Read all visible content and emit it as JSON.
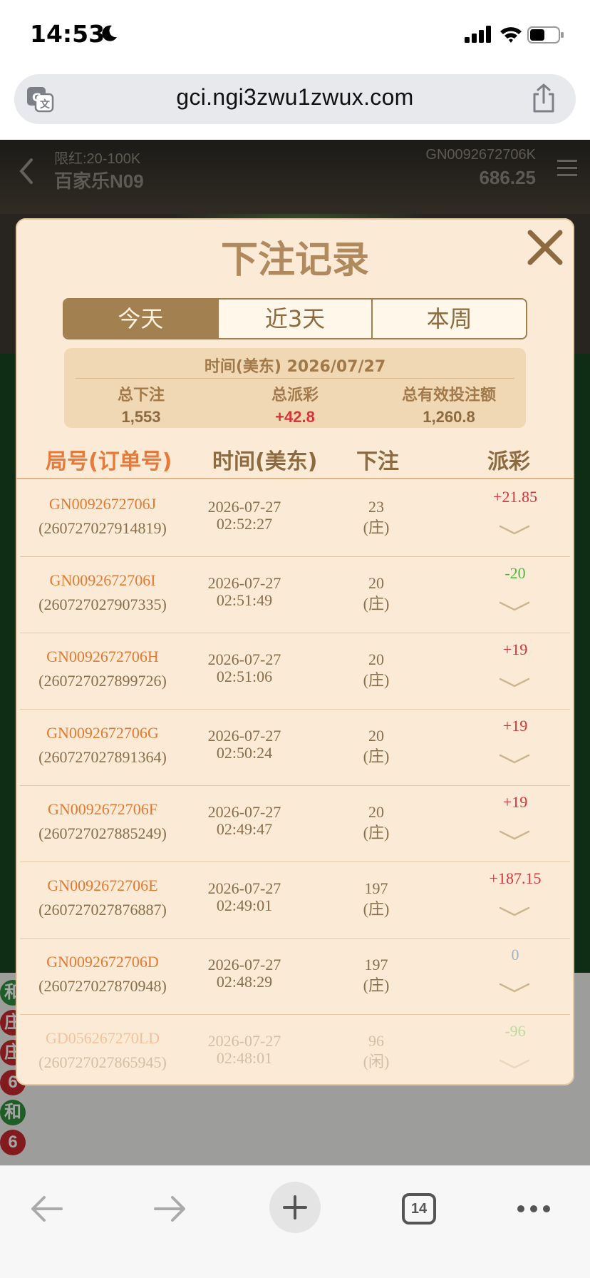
{
  "status": {
    "time": "14:53"
  },
  "browser": {
    "url": "gci.ngi3zwu1zwux.com",
    "tab_count": "14"
  },
  "game": {
    "limit": "限红:20-100K",
    "table_name": "百家乐N09",
    "game_id": "GN0092672706K",
    "balance": "686.25"
  },
  "modal": {
    "title": "下注记录",
    "tabs": [
      {
        "label": "今天",
        "active": true
      },
      {
        "label": "近3天",
        "active": false
      },
      {
        "label": "本周",
        "active": false
      }
    ],
    "summary": {
      "date_line": "时间(美东) 2026/07/27",
      "total_bet_label": "总下注",
      "total_bet_value": "1,553",
      "total_payout_label": "总派彩",
      "total_payout_value": "+42.8",
      "total_valid_label": "总有效投注额",
      "total_valid_value": "1,260.8"
    },
    "headers": {
      "round": "局号(订单号)",
      "time": "时间(美东)",
      "bet": "下注",
      "payout": "派彩"
    },
    "rows": [
      {
        "round": "GN0092672706J",
        "order": "(260727027914819)",
        "date": "2026-07-27",
        "clock": "02:52:27",
        "amount": "23",
        "side": "(庄)",
        "payout": "+21.85",
        "sign": "pos"
      },
      {
        "round": "GN0092672706I",
        "order": "(260727027907335)",
        "date": "2026-07-27",
        "clock": "02:51:49",
        "amount": "20",
        "side": "(庄)",
        "payout": "-20",
        "sign": "neg"
      },
      {
        "round": "GN0092672706H",
        "order": "(260727027899726)",
        "date": "2026-07-27",
        "clock": "02:51:06",
        "amount": "20",
        "side": "(庄)",
        "payout": "+19",
        "sign": "pos"
      },
      {
        "round": "GN0092672706G",
        "order": "(260727027891364)",
        "date": "2026-07-27",
        "clock": "02:50:24",
        "amount": "20",
        "side": "(庄)",
        "payout": "+19",
        "sign": "pos"
      },
      {
        "round": "GN0092672706F",
        "order": "(260727027885249)",
        "date": "2026-07-27",
        "clock": "02:49:47",
        "amount": "20",
        "side": "(庄)",
        "payout": "+19",
        "sign": "pos"
      },
      {
        "round": "GN0092672706E",
        "order": "(260727027876887)",
        "date": "2026-07-27",
        "clock": "02:49:01",
        "amount": "197",
        "side": "(庄)",
        "payout": "+187.15",
        "sign": "pos"
      },
      {
        "round": "GN0092672706D",
        "order": "(260727027870948)",
        "date": "2026-07-27",
        "clock": "02:48:29",
        "amount": "197",
        "side": "(庄)",
        "payout": "0",
        "sign": "zero"
      },
      {
        "round": "GD056267270LD",
        "order": "(260727027865945)",
        "date": "2026-07-27",
        "clock": "02:48:01",
        "amount": "96",
        "side": "(闲)",
        "payout": "-96",
        "sign": "neg"
      }
    ]
  },
  "road_beads": [
    {
      "label": "和",
      "color": "#2f8f3a"
    },
    {
      "label": "庄",
      "color": "#c9282d"
    },
    {
      "label": "庄",
      "color": "#c9282d"
    },
    {
      "label": "6",
      "color": "#c9282d"
    },
    {
      "label": "和",
      "color": "#2f8f3a"
    },
    {
      "label": "6",
      "color": "#c9282d"
    }
  ],
  "colors": {
    "accent": "#a3804f",
    "positive": "#d9343a",
    "negative": "#4fb53c",
    "modal_bg": "#fbebd6"
  }
}
